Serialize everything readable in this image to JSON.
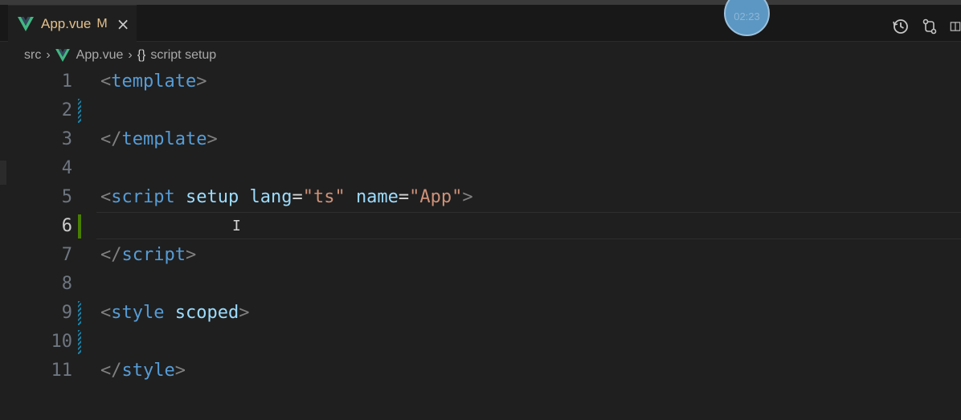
{
  "tab": {
    "title": "App.vue",
    "badge": "M",
    "close_label": "×",
    "icon": "vue-icon"
  },
  "timer": {
    "text": "02:23"
  },
  "actions": {
    "icons": [
      "history-icon",
      "compare-changes-icon",
      "split-editor-icon"
    ]
  },
  "breadcrumb": {
    "folder": "src",
    "file": "App.vue",
    "symbol_icon": "{}",
    "symbol": "script setup"
  },
  "editor": {
    "active_line": 6,
    "lines": [
      {
        "num": "1",
        "tokens": [
          [
            "bracket",
            "<"
          ],
          [
            "tag",
            "template"
          ],
          [
            "bracket",
            ">"
          ]
        ],
        "mark": ""
      },
      {
        "num": "2",
        "tokens": [],
        "mark": "mod"
      },
      {
        "num": "3",
        "tokens": [
          [
            "bracket",
            "</"
          ],
          [
            "tag",
            "template"
          ],
          [
            "bracket",
            ">"
          ]
        ],
        "mark": ""
      },
      {
        "num": "4",
        "tokens": [],
        "mark": ""
      },
      {
        "num": "5",
        "tokens": [
          [
            "bracket",
            "<"
          ],
          [
            "tag",
            "script"
          ],
          [
            "eq",
            " "
          ],
          [
            "attr",
            "setup"
          ],
          [
            "eq",
            " "
          ],
          [
            "attr",
            "lang"
          ],
          [
            "eq",
            "="
          ],
          [
            "str",
            "\"ts\""
          ],
          [
            "eq",
            " "
          ],
          [
            "attr",
            "name"
          ],
          [
            "eq",
            "="
          ],
          [
            "str",
            "\"App\""
          ],
          [
            "bracket",
            ">"
          ]
        ],
        "mark": ""
      },
      {
        "num": "6",
        "tokens": [],
        "mark": "add"
      },
      {
        "num": "7",
        "tokens": [
          [
            "bracket",
            "</"
          ],
          [
            "tag",
            "script"
          ],
          [
            "bracket",
            ">"
          ]
        ],
        "mark": ""
      },
      {
        "num": "8",
        "tokens": [],
        "mark": ""
      },
      {
        "num": "9",
        "tokens": [
          [
            "bracket",
            "<"
          ],
          [
            "tag",
            "style"
          ],
          [
            "eq",
            " "
          ],
          [
            "attr",
            "scoped"
          ],
          [
            "bracket",
            ">"
          ]
        ],
        "mark": "mod"
      },
      {
        "num": "10",
        "tokens": [],
        "mark": "mod"
      },
      {
        "num": "11",
        "tokens": [
          [
            "bracket",
            "</"
          ],
          [
            "tag",
            "style"
          ],
          [
            "bracket",
            ">"
          ]
        ],
        "mark": ""
      }
    ],
    "cursor_glyph": "I"
  },
  "colors": {
    "background": "#1f1f1f",
    "tag": "#569cd6",
    "attr": "#9cdcfe",
    "string": "#ce9178",
    "bracket": "#808080",
    "modified": "#e2c08d"
  }
}
